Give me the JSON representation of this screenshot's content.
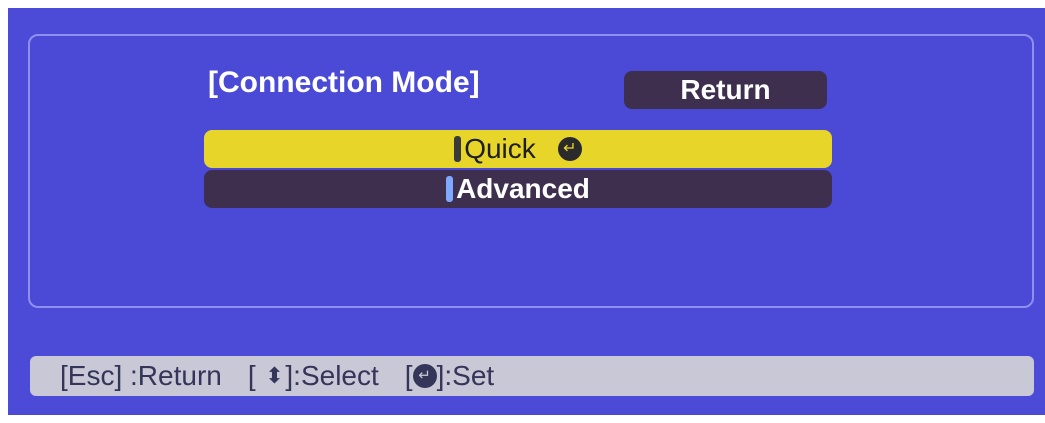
{
  "dialog": {
    "title": "[Connection Mode]",
    "return_button": "Return",
    "options": [
      {
        "label": "Quick",
        "selected": true
      },
      {
        "label": "Advanced",
        "selected": false
      }
    ]
  },
  "help_bar": {
    "esc_key": "[Esc]",
    "esc_text": ":Return",
    "select_open": "[",
    "select_close": "]:Select",
    "set_open": "[",
    "set_close": "]:Set"
  },
  "colors": {
    "background": "#4b4bd8",
    "selected_option": "#e8d52a",
    "unselected_option": "#3d2f4d",
    "help_bar": "#c8c8d6"
  },
  "icons": {
    "enter": "enter-icon",
    "up_down": "updown-icon"
  }
}
